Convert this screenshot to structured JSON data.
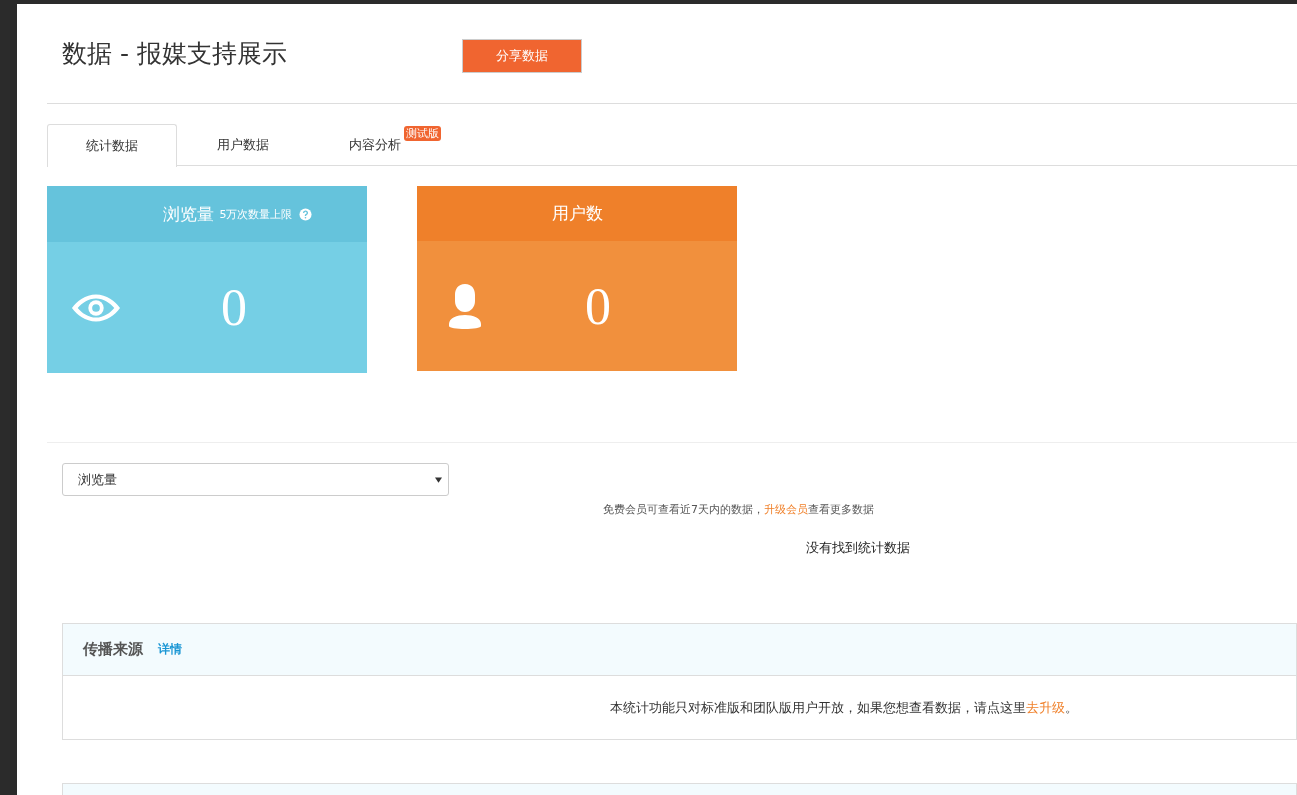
{
  "header": {
    "title": "数据 - 报媒支持展示",
    "share_button": "分享数据"
  },
  "tabs": [
    {
      "label": "统计数据",
      "selected": true
    },
    {
      "label": "用户数据",
      "selected": false
    },
    {
      "label": "内容分析",
      "selected": false,
      "badge": "测试版"
    }
  ],
  "cards": [
    {
      "kind": "views",
      "title": "浏览量",
      "note": "5万次数量上限",
      "help": true,
      "value": "0"
    },
    {
      "kind": "users",
      "title": "用户数",
      "value": "0"
    }
  ],
  "metric_select": {
    "value": "浏览量"
  },
  "notice": {
    "before": "免费会员可查看近7天内的数据，",
    "link": "升级会员",
    "after": "查看更多数据"
  },
  "empty_message": "没有找到统计数据",
  "panels": [
    {
      "kind": "detail",
      "title": "传播来源",
      "link": "详情",
      "message_before": "本统计功能只对标准版和团队版用户开放，如果您想查看数据，请点这里",
      "message_link": "去升级",
      "message_after": "。"
    },
    {
      "kind": "stub"
    }
  ]
}
